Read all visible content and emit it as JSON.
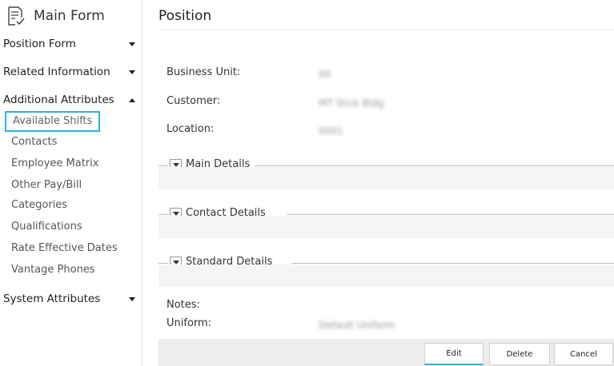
{
  "sidebar": {
    "title": "Main Form",
    "sections": {
      "position_form": "Position Form",
      "related_information": "Related Information",
      "additional_attributes": "Additional Attributes",
      "system_attributes": "System Attributes"
    },
    "additional_items": [
      "Available Shifts",
      "Contacts",
      "Employee Matrix",
      "Other Pay/Bill",
      "Categories",
      "Qualifications",
      "Rate Effective Dates",
      "Vantage Phones"
    ]
  },
  "main": {
    "title": "Position",
    "fields": {
      "business_unit_label": "Business Unit:",
      "business_unit_value": "00",
      "customer_label": "Customer:",
      "customer_value": "MT Stick Bldg",
      "location_label": "Location:",
      "location_value": "0001"
    },
    "sections": {
      "main_details": "Main Details",
      "contact_details": "Contact Details",
      "standard_details": "Standard Details"
    },
    "notes_label": "Notes:",
    "uniform_label": "Uniform:",
    "uniform_value": "Default Uniform"
  },
  "footer": {
    "edit": "Edit",
    "delete": "Delete",
    "cancel": "Cancel"
  },
  "colors": {
    "accent": "#2ab4dc",
    "section_fill": "#f5f5f5",
    "footer_fill": "#ededed"
  }
}
